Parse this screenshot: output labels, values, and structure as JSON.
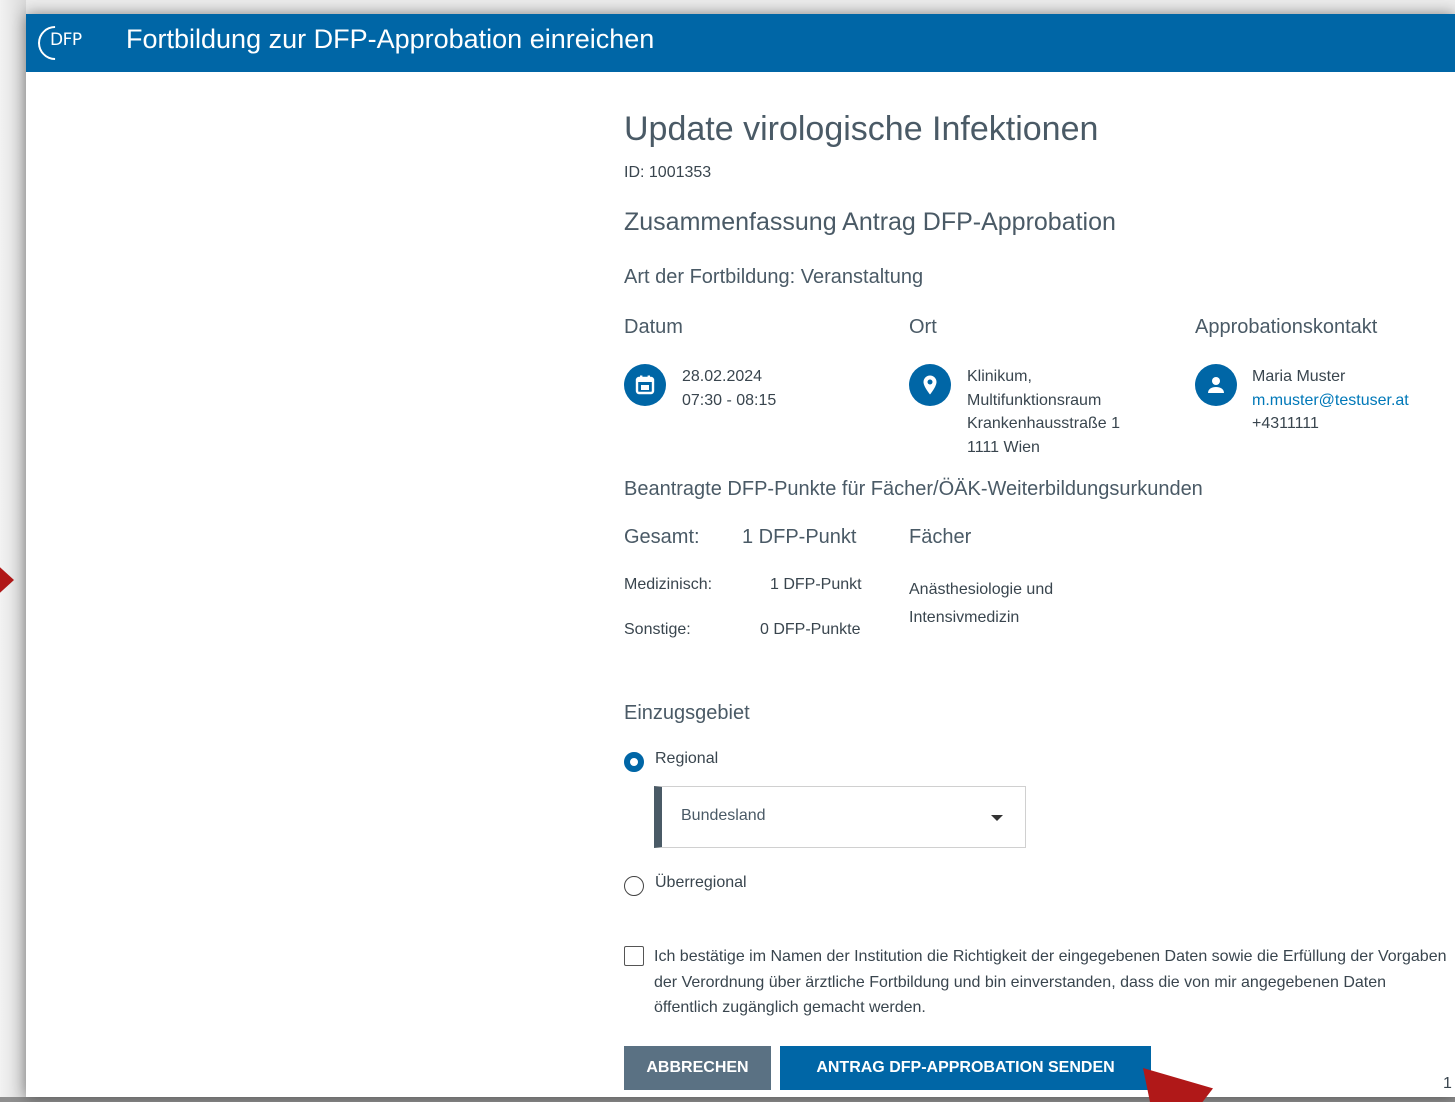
{
  "header": {
    "logo_text": "DFP",
    "title": "Fortbildung zur DFP-Approbation einreichen"
  },
  "course": {
    "title": "Update virologische Infektionen",
    "id": "ID: 1001353"
  },
  "summary": {
    "heading": "Zusammenfassung Antrag DFP-Approbation",
    "type_line": "Art der Fortbildung: Veranstaltung"
  },
  "columns": {
    "date": {
      "heading": "Datum",
      "icon": "calendar-icon",
      "line1": "28.02.2024",
      "line2": "07:30 - 08:15"
    },
    "location": {
      "heading": "Ort",
      "icon": "location-pin-icon",
      "line1": "Klinikum,",
      "line2": "Multifunktionsraum",
      "line3": "Krankenhausstraße 1",
      "line4": "1111 Wien"
    },
    "contact": {
      "heading": "Approbationskontakt",
      "icon": "person-icon",
      "name": "Maria Muster",
      "email": "m.muster@testuser.at",
      "phone": "+4311111"
    }
  },
  "points": {
    "heading": "Beantragte DFP-Punkte für Fächer/ÖÄK-Weiterbildungsurkunden",
    "total_label": "Gesamt:",
    "total_value": "1 DFP-Punkt",
    "subjects_heading": "Fächer",
    "medical_label": "Medizinisch:",
    "medical_value": "1 DFP-Punkt",
    "other_label": "Sonstige:",
    "other_value": "0 DFP-Punkte",
    "subject_line1": "Anästhesiologie und",
    "subject_line2": "Intensivmedizin"
  },
  "region": {
    "heading": "Einzugsgebiet",
    "option_regional": "Regional",
    "option_supraregional": "Überregional",
    "selected": "Regional",
    "state_select_placeholder": "Bundesland"
  },
  "confirmation": {
    "text": "Ich bestätige im Namen der Institution die Richtigkeit der eingegebenen Daten sowie die Erfüllung der Vorgaben der Verordnung über ärztliche Fortbildung und bin einverstanden, dass die von mir angegebenen Daten öffentlich zugänglich gemacht werden.",
    "checked": false
  },
  "buttons": {
    "cancel": "ABBRECHEN",
    "submit": "ANTRAG DFP-APPROBATION SENDEN"
  },
  "corner_text": "1",
  "colors": {
    "primary": "#0066a6",
    "secondary_button": "#5a7183",
    "text": "#4a5a66",
    "annotation_arrow": "#b01818"
  }
}
